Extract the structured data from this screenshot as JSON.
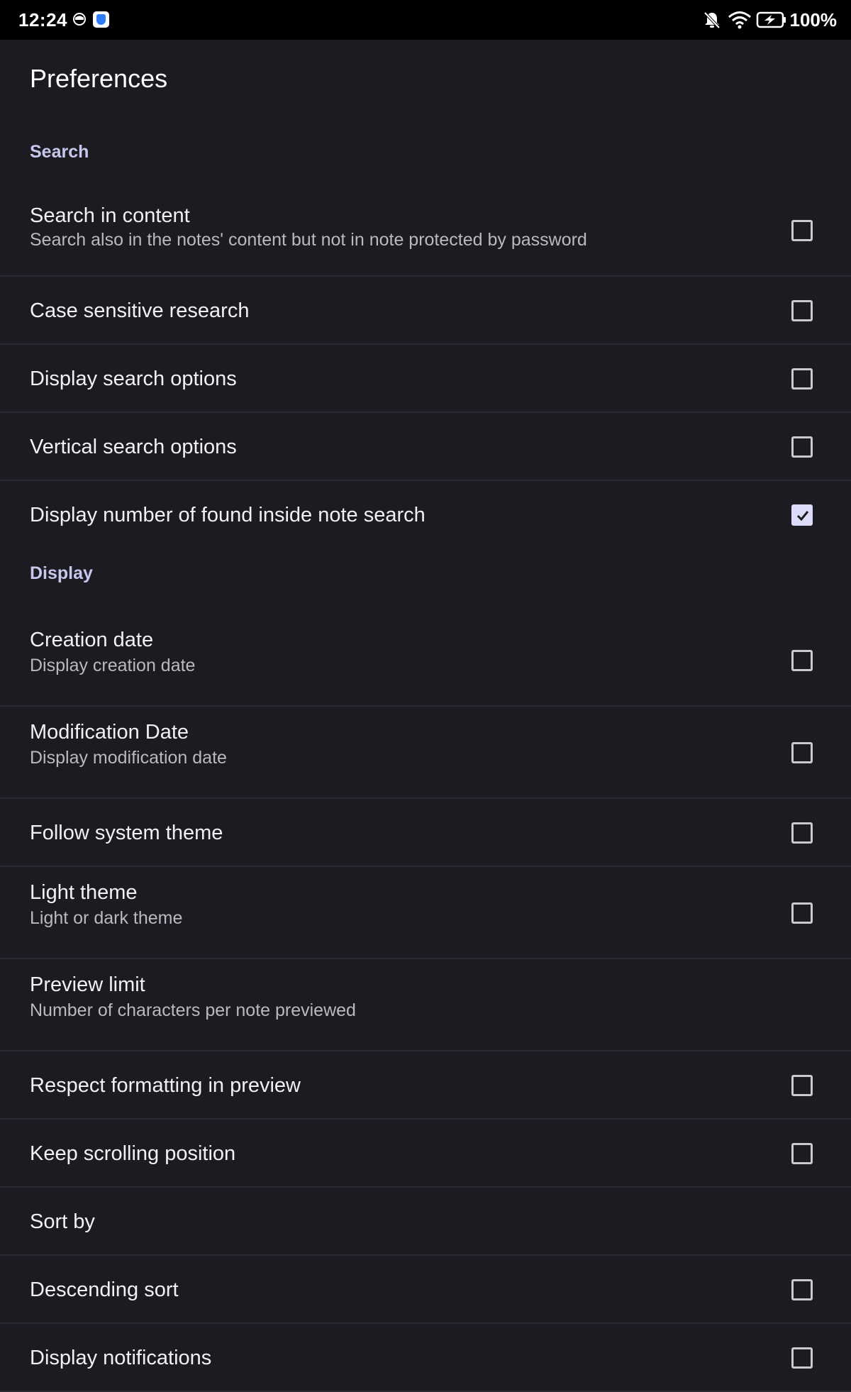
{
  "status_bar": {
    "time": "12:24",
    "battery": "100%"
  },
  "app_bar": {
    "title": "Preferences"
  },
  "sections": {
    "search": {
      "header": "Search",
      "items": [
        {
          "title": "Search in content",
          "summary": "Search also in the notes' content but not in note protected by password",
          "checked": false
        },
        {
          "title": "Case sensitive research",
          "checked": false
        },
        {
          "title": "Display search options",
          "checked": false
        },
        {
          "title": "Vertical search options",
          "checked": false
        },
        {
          "title": "Display number of found inside note search",
          "checked": true
        }
      ]
    },
    "display": {
      "header": "Display",
      "items": [
        {
          "title": "Creation date",
          "summary": "Display creation date",
          "checked": false
        },
        {
          "title": "Modification Date",
          "summary": "Display modification date",
          "checked": false
        },
        {
          "title": "Follow system theme",
          "checked": false
        },
        {
          "title": "Light theme",
          "summary": "Light or dark theme",
          "checked": false
        },
        {
          "title": "Preview limit",
          "summary": "Number of characters per note previewed"
        },
        {
          "title": "Respect formatting in preview",
          "checked": false
        },
        {
          "title": "Keep scrolling position",
          "checked": false
        },
        {
          "title": "Sort by"
        },
        {
          "title": "Descending sort",
          "checked": false
        },
        {
          "title": "Display notifications",
          "checked": false
        }
      ]
    }
  },
  "colors": {
    "background": "#1c1b22",
    "section_header": "#c7c7ee",
    "checkbox_checked": "#dcdcf8",
    "divider": "#2b2a32"
  }
}
